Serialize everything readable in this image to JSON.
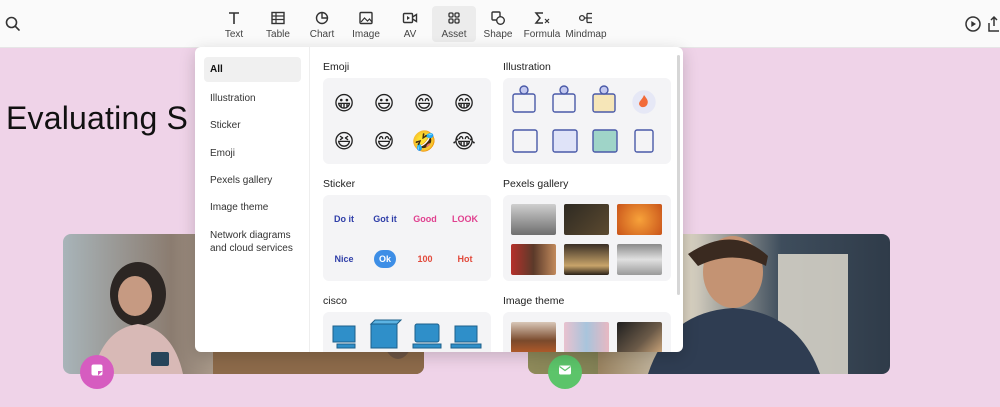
{
  "toolbar": {
    "tools": [
      {
        "label": "Text",
        "icon": "text-icon"
      },
      {
        "label": "Table",
        "icon": "table-icon"
      },
      {
        "label": "Chart",
        "icon": "chart-icon"
      },
      {
        "label": "Image",
        "icon": "image-icon"
      },
      {
        "label": "AV",
        "icon": "video-icon"
      },
      {
        "label": "Asset",
        "icon": "asset-icon"
      },
      {
        "label": "Shape",
        "icon": "shape-icon"
      },
      {
        "label": "Formula",
        "icon": "formula-icon"
      },
      {
        "label": "Mindmap",
        "icon": "mindmap-icon"
      }
    ],
    "active_tool": "Asset"
  },
  "slide": {
    "title": "Evaluating S"
  },
  "asset_panel": {
    "categories": [
      "All",
      "Illustration",
      "Sticker",
      "Emoji",
      "Pexels gallery",
      "Image theme",
      "Network diagrams and cloud services"
    ],
    "active_category": "All",
    "sections": {
      "emoji": {
        "title": "Emoji",
        "items": [
          "😀",
          "😃",
          "😄",
          "😁",
          "😆",
          "😅",
          "🤣",
          "😂"
        ]
      },
      "illustration": {
        "title": "Illustration"
      },
      "sticker": {
        "title": "Sticker",
        "items": [
          "Do it",
          "Got it",
          "Good",
          "LOOK",
          "Nice",
          "Ok",
          "100",
          "Hot"
        ]
      },
      "pexels": {
        "title": "Pexels gallery"
      },
      "cisco": {
        "title": "cisco"
      },
      "image_theme": {
        "title": "Image theme"
      }
    }
  },
  "colors": {
    "slide_bg": "#efd3e8",
    "fab_left": "#d65cc0",
    "fab_right": "#5cc46a"
  }
}
